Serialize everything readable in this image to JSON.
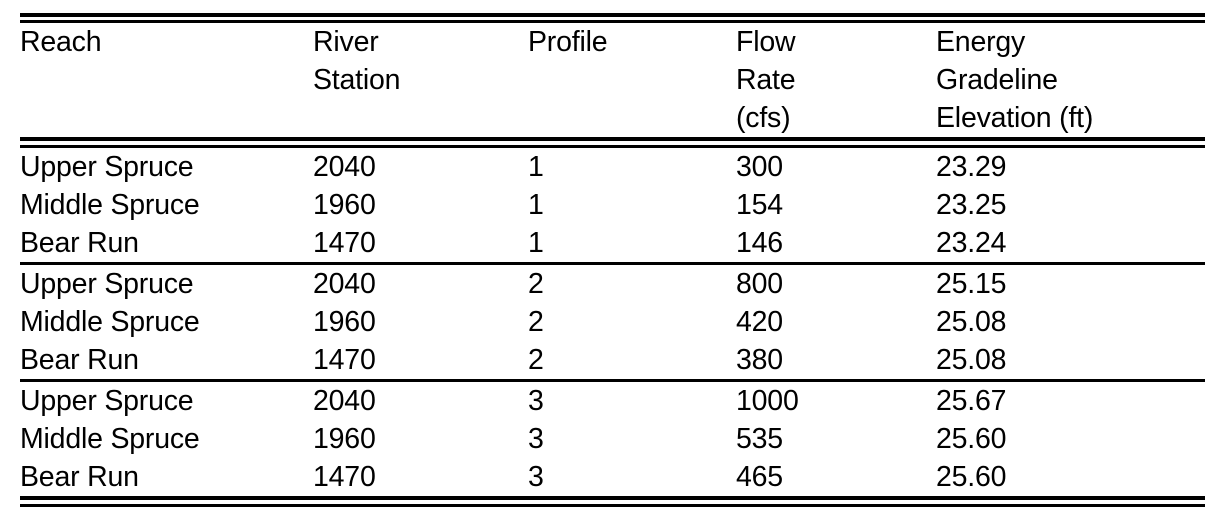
{
  "table": {
    "caption": "",
    "columns": [
      {
        "key": "reach",
        "label_lines": [
          "Reach"
        ]
      },
      {
        "key": "station",
        "label_lines": [
          "River",
          "Station"
        ]
      },
      {
        "key": "profile",
        "label_lines": [
          "Profile"
        ]
      },
      {
        "key": "flow",
        "label_lines": [
          "Flow",
          "Rate",
          "(cfs)"
        ]
      },
      {
        "key": "energy",
        "label_lines": [
          "Energy",
          "Gradeline",
          "Elevation (ft)"
        ]
      }
    ],
    "groups": [
      {
        "profile": "1",
        "rows": [
          {
            "reach": "Upper Spruce",
            "station": "2040",
            "profile": "1",
            "flow": "300",
            "energy": "23.29"
          },
          {
            "reach": "Middle Spruce",
            "station": "1960",
            "profile": "1",
            "flow": "154",
            "energy": "23.25"
          },
          {
            "reach": "Bear Run",
            "station": "1470",
            "profile": "1",
            "flow": "146",
            "energy": "23.24"
          }
        ]
      },
      {
        "profile": "2",
        "rows": [
          {
            "reach": "Upper Spruce",
            "station": "2040",
            "profile": "2",
            "flow": "800",
            "energy": "25.15"
          },
          {
            "reach": "Middle Spruce",
            "station": "1960",
            "profile": "2",
            "flow": "420",
            "energy": "25.08"
          },
          {
            "reach": "Bear Run",
            "station": "1470",
            "profile": "2",
            "flow": "380",
            "energy": "25.08"
          }
        ]
      },
      {
        "profile": "3",
        "rows": [
          {
            "reach": "Upper Spruce",
            "station": "2040",
            "profile": "3",
            "flow": "1000",
            "energy": "25.67"
          },
          {
            "reach": "Middle Spruce",
            "station": "1960",
            "profile": "3",
            "flow": "535",
            "energy": "25.60"
          },
          {
            "reach": "Bear Run",
            "station": "1470",
            "profile": "3",
            "flow": "465",
            "energy": "25.60"
          }
        ]
      }
    ],
    "colors": {
      "text": "#000000",
      "rule": "#000000",
      "background": "#ffffff"
    }
  }
}
